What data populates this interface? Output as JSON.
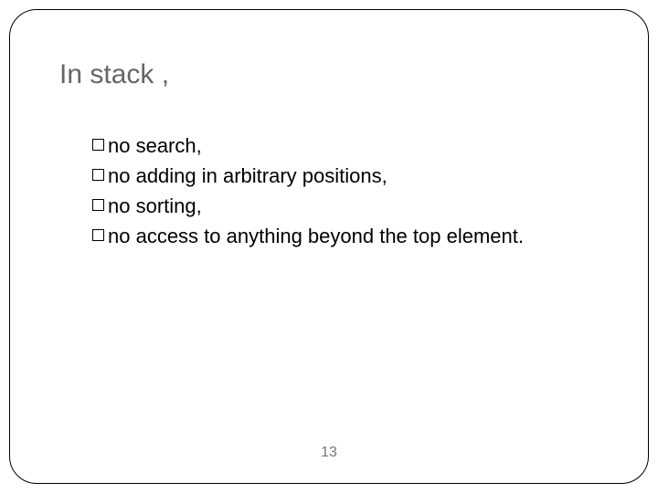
{
  "title": "In stack ,",
  "bullets": [
    "no search,",
    "no adding in arbitrary positions,",
    "no sorting,",
    "no access to anything beyond the top element."
  ],
  "page_number": "13"
}
